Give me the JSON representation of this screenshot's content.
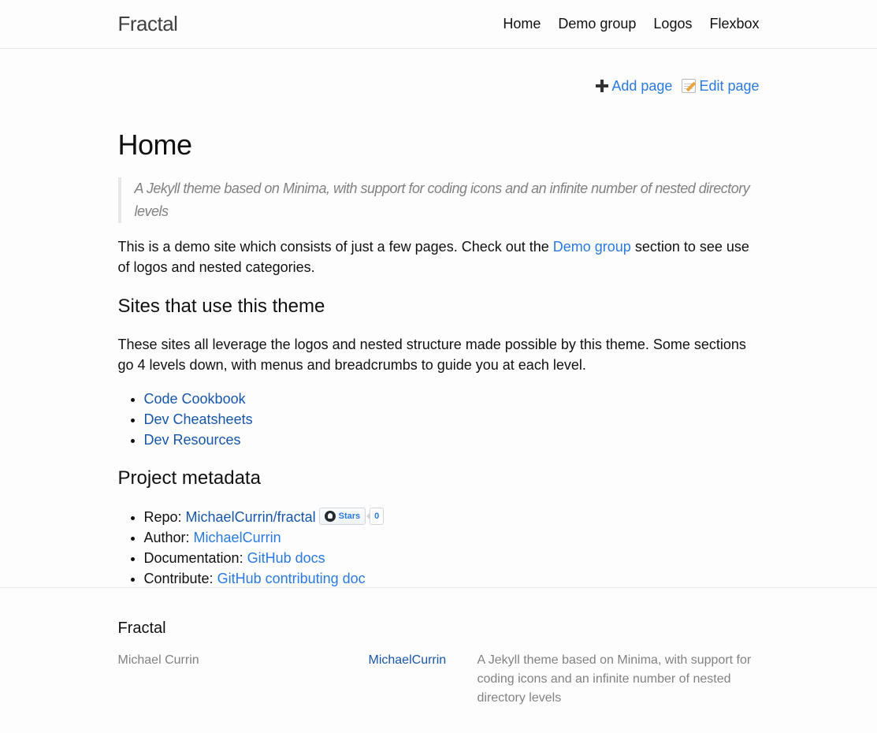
{
  "header": {
    "site_title": "Fractal",
    "nav": [
      {
        "label": "Home"
      },
      {
        "label": "Demo group"
      },
      {
        "label": "Logos"
      },
      {
        "label": "Flexbox"
      }
    ]
  },
  "actions": {
    "add_page": "Add page",
    "edit_page": "Edit page"
  },
  "page": {
    "title": "Home",
    "quote": "A Jekyll theme based on Minima, with support for coding icons and an infinite number of nested directory levels",
    "intro_before": "This is a demo site which consists of just a few pages. Check out the ",
    "intro_link": "Demo group",
    "intro_after": " section to see use of logos and nested categories.",
    "sites_heading": "Sites that use this theme",
    "sites_desc": "These sites all leverage the logos and nested structure made possible by this theme. Some sections go 4 levels down, with menus and breadcrumbs to guide you at each level.",
    "sites": [
      {
        "label": "Code Cookbook"
      },
      {
        "label": "Dev Cheatsheets"
      },
      {
        "label": "Dev Resources"
      }
    ],
    "meta_heading": "Project metadata",
    "meta": {
      "repo_label": "Repo: ",
      "repo_link": "MichaelCurrin/fractal",
      "stars_label": "Stars",
      "stars_count": "0",
      "author_label": "Author: ",
      "author_link": "MichaelCurrin",
      "docs_label": "Documentation: ",
      "docs_link": "GitHub docs",
      "contribute_label": "Contribute: ",
      "contribute_link": "GitHub contributing doc"
    }
  },
  "footer": {
    "heading": "Fractal",
    "author_name": "Michael Currin",
    "github_user": "MichaelCurrin",
    "description": "A Jekyll theme based on Minima, with support for coding icons and an infinite number of nested directory levels"
  }
}
